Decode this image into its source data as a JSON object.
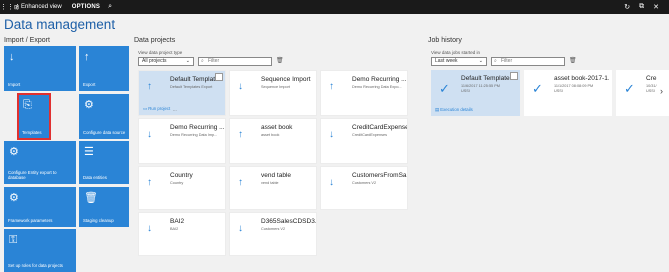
{
  "topbar": {
    "view_label": "Enhanced view",
    "options_label": "OPTIONS"
  },
  "page_title": "Data management",
  "import_export": {
    "heading": "Import / Export",
    "tiles": [
      {
        "label": "Import"
      },
      {
        "label": "Export"
      },
      {
        "label": "Templates"
      },
      {
        "label": "Configure data source"
      },
      {
        "label": "Configure Entity export to database"
      },
      {
        "label": "Data entities"
      },
      {
        "label": "Framework parameters"
      },
      {
        "label": "Staging cleanup"
      },
      {
        "label": "Set up roles for data projects"
      }
    ]
  },
  "projects": {
    "heading": "Data projects",
    "type_label": "View data project type",
    "type_value": "All projects",
    "filter_placeholder": "Filter",
    "run_project": "Run project",
    "more": "...",
    "cards": [
      {
        "name": "Default Templates...",
        "sub": "Default Templates Export"
      },
      {
        "name": "Sequence Import",
        "sub": "Sequence Import"
      },
      {
        "name": "Demo Recurring ...",
        "sub": "Demo Recurring Data Expo..."
      },
      {
        "name": "Demo Recurring ...",
        "sub": "Demo Recurring Data Imp..."
      },
      {
        "name": "asset book",
        "sub": "asset book"
      },
      {
        "name": "CreditCardExpenses",
        "sub": "CreditCardExpenses"
      },
      {
        "name": "Country",
        "sub": "Country"
      },
      {
        "name": "vend table",
        "sub": "vend table"
      },
      {
        "name": "CustomersFromSa...",
        "sub": "Customers V2"
      },
      {
        "name": "BAI2",
        "sub": "BAI2"
      },
      {
        "name": "D365SalesCDSD3...",
        "sub": "Customers V2"
      }
    ]
  },
  "jobs": {
    "heading": "Job history",
    "range_label": "View data jobs started in",
    "range_value": "Last week",
    "filter_placeholder": "Filter",
    "execution_details": "Execution details",
    "cards": [
      {
        "name": "Default Templates...",
        "line1": "11/6/2017 11:25:55 PM",
        "line2": "USSI"
      },
      {
        "name": "asset book-2017-1...",
        "line1": "11/1/2017 08:08:09 PM",
        "line2": "USSI"
      },
      {
        "name": "Cre",
        "line1": "10/31/",
        "line2": "USSI"
      }
    ]
  }
}
